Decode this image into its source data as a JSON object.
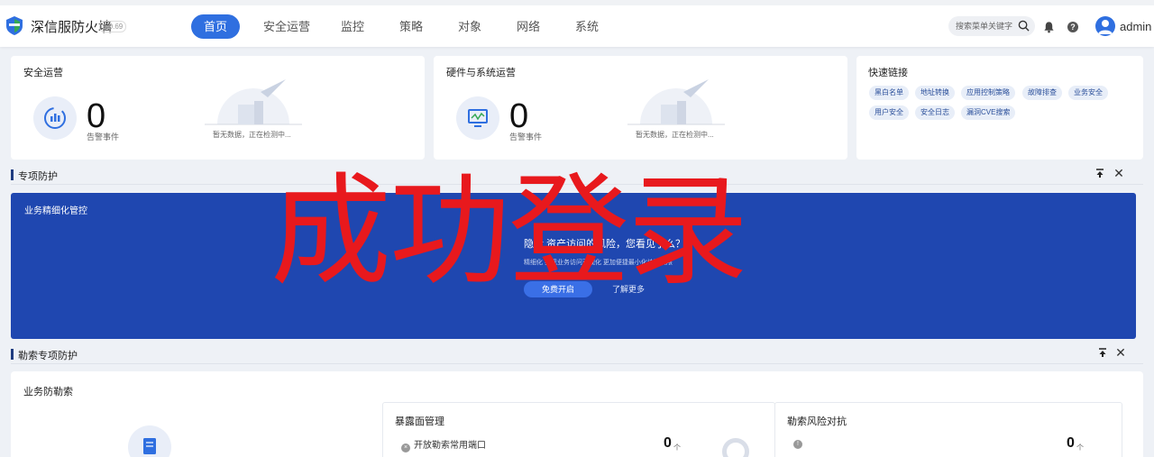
{
  "header": {
    "brand": "深信服防火墙",
    "version": "8.0.69",
    "nav": [
      "首页",
      "安全运营",
      "监控",
      "策略",
      "对象",
      "网络",
      "系统"
    ],
    "active_nav": "首页",
    "search_placeholder": "搜索菜单关键字",
    "username": "admin"
  },
  "cards": {
    "security_ops": {
      "title": "安全运营",
      "count": "0",
      "count_label": "告警事件",
      "empty_text": "暂无数据，正在检测中..."
    },
    "hardware_ops": {
      "title": "硬件与系统运营",
      "count": "0",
      "count_label": "告警事件",
      "empty_text": "暂无数据，正在检测中..."
    },
    "quick_links": {
      "title": "快速链接",
      "links": [
        "黑白名单",
        "地址转换",
        "应用控制策略",
        "故障排查",
        "业务安全",
        "用户安全",
        "安全日志",
        "漏洞CVE搜索"
      ]
    }
  },
  "special_protection": {
    "title": "专项防护",
    "banner_title": "业务精细化管控",
    "banner_headline": "隐含  资产访问的风险，您看见了么？",
    "banner_sub": "精细化  实现业务访问可视化  更加便捷最小化访问权限",
    "btn_primary": "免费开启",
    "btn_secondary": "了解更多"
  },
  "overlay": "成功登录",
  "ransomware": {
    "title": "勒索专项防护",
    "card_title": "业务防勒索",
    "exposure": {
      "title": "暴露面管理",
      "row": "开放勒索常用端口",
      "count": "0",
      "unit": "个"
    },
    "risk": {
      "title": "勒索风险对抗",
      "count": "0",
      "unit": "个"
    }
  }
}
